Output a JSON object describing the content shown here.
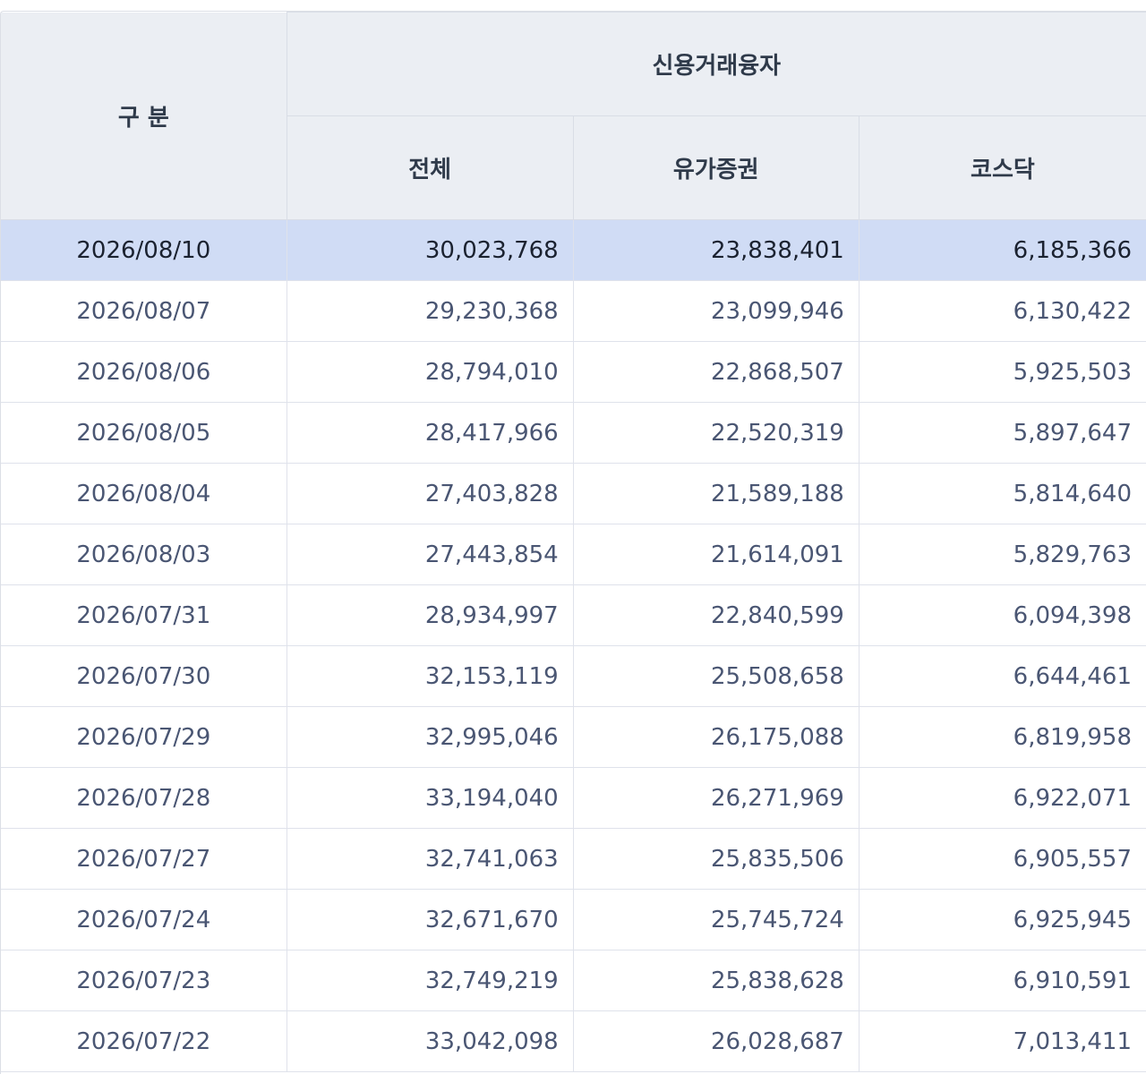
{
  "table": {
    "header": {
      "row_label": "구 분",
      "group_label": "신용거래융자",
      "columns": [
        "전체",
        "유가증권",
        "코스닥"
      ]
    },
    "rows": [
      {
        "date": "2026/08/10",
        "total": "30,023,768",
        "kospi": "23,838,401",
        "kosdaq": "6,185,366",
        "selected": true
      },
      {
        "date": "2026/08/07",
        "total": "29,230,368",
        "kospi": "23,099,946",
        "kosdaq": "6,130,422"
      },
      {
        "date": "2026/08/06",
        "total": "28,794,010",
        "kospi": "22,868,507",
        "kosdaq": "5,925,503"
      },
      {
        "date": "2026/08/05",
        "total": "28,417,966",
        "kospi": "22,520,319",
        "kosdaq": "5,897,647"
      },
      {
        "date": "2026/08/04",
        "total": "27,403,828",
        "kospi": "21,589,188",
        "kosdaq": "5,814,640"
      },
      {
        "date": "2026/08/03",
        "total": "27,443,854",
        "kospi": "21,614,091",
        "kosdaq": "5,829,763"
      },
      {
        "date": "2026/07/31",
        "total": "28,934,997",
        "kospi": "22,840,599",
        "kosdaq": "6,094,398"
      },
      {
        "date": "2026/07/30",
        "total": "32,153,119",
        "kospi": "25,508,658",
        "kosdaq": "6,644,461"
      },
      {
        "date": "2026/07/29",
        "total": "32,995,046",
        "kospi": "26,175,088",
        "kosdaq": "6,819,958"
      },
      {
        "date": "2026/07/28",
        "total": "33,194,040",
        "kospi": "26,271,969",
        "kosdaq": "6,922,071"
      },
      {
        "date": "2026/07/27",
        "total": "32,741,063",
        "kospi": "25,835,506",
        "kosdaq": "6,905,557"
      },
      {
        "date": "2026/07/24",
        "total": "32,671,670",
        "kospi": "25,745,724",
        "kosdaq": "6,925,945"
      },
      {
        "date": "2026/07/23",
        "total": "32,749,219",
        "kospi": "25,838,628",
        "kosdaq": "6,910,591"
      },
      {
        "date": "2026/07/22",
        "total": "33,042,098",
        "kospi": "26,028,687",
        "kosdaq": "7,013,411"
      }
    ]
  }
}
